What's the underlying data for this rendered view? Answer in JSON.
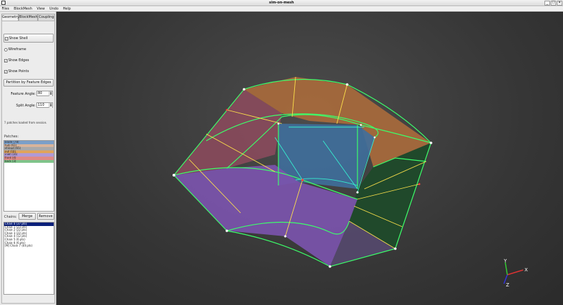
{
  "window": {
    "title": "sim-on-mesh",
    "buttons": {
      "minimize": "_",
      "maximize": "☐",
      "close": "✕"
    }
  },
  "menu": [
    "Files",
    "BlockMesh",
    "View",
    "Undo",
    "Help"
  ],
  "tabs": [
    "Geometry",
    "BlockMesh",
    "Coupling"
  ],
  "geometry": {
    "show_shell": "Show Shell",
    "wireframe": "Wireframe",
    "show_edges": "Show Edges",
    "show_points": "Show Points",
    "partition_button": "Partition by Feature Edges",
    "feature_angle_label": "Feature Angle:",
    "feature_angle_value": "80",
    "split_angle_label": "Split Angle:",
    "split_angle_value": "110",
    "status_note": "7 patches loaded from session.",
    "patches_label": "Patches:",
    "patches": [
      {
        "label": "blade (78)",
        "color": "#7b9fc9"
      },
      {
        "label": "hub (61)",
        "color": "#d8b49b"
      },
      {
        "label": "shroud (65)",
        "color": "#a9a9a9"
      },
      {
        "label": "out (16)",
        "color": "#e0a45c"
      },
      {
        "label": "inlet (16)",
        "color": "#b09ad6"
      },
      {
        "label": "front (4)",
        "color": "#e08a86"
      },
      {
        "label": "back (3)",
        "color": "#7fc48a"
      }
    ],
    "chains_label": "Chains:",
    "merge_button": "Merge",
    "remove_button": "Remove",
    "chains": [
      "Chain 0 (37 pts)",
      "Chain 1 (23 pts)",
      "Chain 2 (22 pts)",
      "Chain 3 (22 pts)",
      "Chain 4 (12 pts)",
      "Chain 5 (6 pts)",
      "Chain 6 (6 pts)",
      "[M] Chain 7 (44 pts)"
    ]
  },
  "axes": {
    "x": "X",
    "y": "Y",
    "z": "Z"
  },
  "colors": {
    "top_face": "#a86a3c",
    "front_face": "#7b54ad",
    "left_face": "#8a4a5c",
    "right_face": "#1f4a2a",
    "blade_face": "#3f6f9c",
    "edge_green": "#3cff6a",
    "edge_yellow": "#ffe34a",
    "edge_cyan": "#35f0d0",
    "axis_x": "#d33",
    "axis_y": "#3c3",
    "axis_z": "#33d"
  }
}
